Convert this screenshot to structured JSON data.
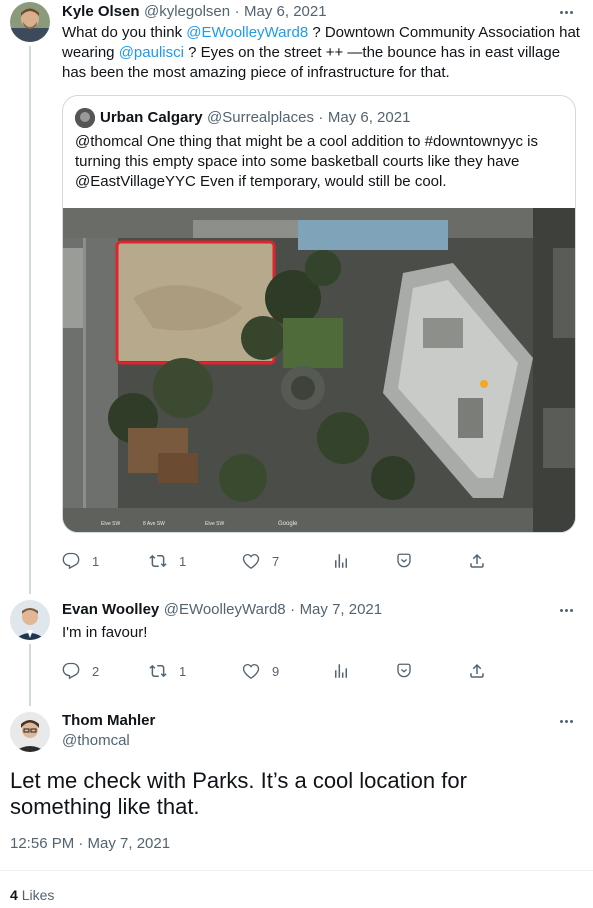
{
  "tweet1": {
    "name": "Kyle Olsen",
    "handle": "@kylegolsen",
    "date": "May 6, 2021",
    "text_1": "What do you think ",
    "mention_1": "@EWoolleyWard8",
    "text_2": " ? Downtown Community Association hat wearing ",
    "mention_2": "@paulisci",
    "text_3": " ? Eyes on the street ++   —the bounce has in east village has been the most amazing piece of infrastructure for that.",
    "quote": {
      "name": "Urban Calgary",
      "handle": "@Surrealplaces",
      "date": "May 6, 2021",
      "text": "@thomcal  One thing that might be a cool addition to #downtownyyc is turning this empty space into some basketball courts like they have @EastVillageYYC Even if temporary, would still be cool.",
      "map_labels": [
        "Elve SW",
        "8 Ave SW",
        "Elve SW",
        "Google"
      ]
    },
    "replies": "1",
    "retweets": "1",
    "likes": "7"
  },
  "tweet2": {
    "name": "Evan Woolley",
    "handle": "@EWoolleyWard8",
    "date": "May 7, 2021",
    "text": "I'm in favour!",
    "replies": "2",
    "retweets": "1",
    "likes": "9"
  },
  "tweet3": {
    "name": "Thom Mahler",
    "handle": "@thomcal",
    "text": "Let me check with Parks. It’s a cool location for something like that.",
    "timestamp": "12:56 PM · May 7, 2021",
    "likes_count": "4",
    "likes_label": "Likes"
  },
  "colors": {
    "accent": "#1d9bf0",
    "secondary_text": "#536471",
    "border": "#cfd9de",
    "highlight_box": "#e0242b"
  },
  "icons": [
    "reply-icon",
    "retweet-icon",
    "like-icon",
    "views-icon",
    "bookmark-icon",
    "share-icon",
    "more-icon"
  ]
}
